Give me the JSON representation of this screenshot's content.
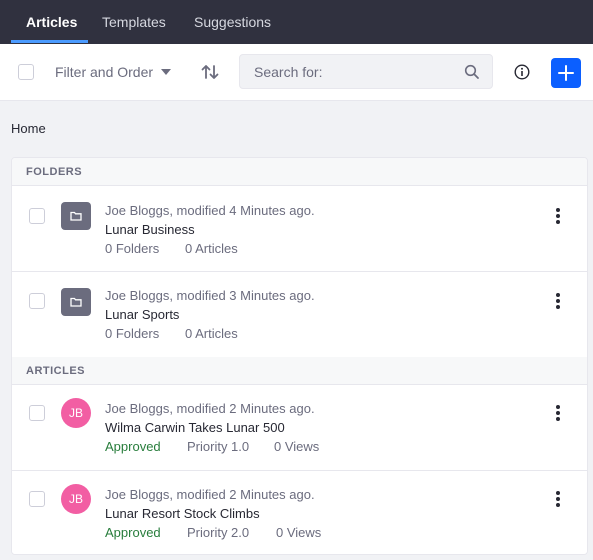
{
  "nav": {
    "tabs": [
      {
        "label": "Articles",
        "active": true
      },
      {
        "label": "Templates",
        "active": false
      },
      {
        "label": "Suggestions",
        "active": false
      }
    ]
  },
  "toolbar": {
    "filter_label": "Filter and Order",
    "search_placeholder": "Search for:",
    "accent_color": "#0b5fff"
  },
  "breadcrumb": "Home",
  "folders": {
    "header": "FOLDERS",
    "items": [
      {
        "meta": "Joe Bloggs, modified 4 Minutes ago.",
        "title": "Lunar Business",
        "subfolders": "0 Folders",
        "articles": "0 Articles",
        "icon": "folder-icon"
      },
      {
        "meta": "Joe Bloggs, modified 3 Minutes ago.",
        "title": "Lunar Sports",
        "subfolders": "0 Folders",
        "articles": "0 Articles",
        "icon": "folder-icon"
      }
    ]
  },
  "articles": {
    "header": "ARTICLES",
    "items": [
      {
        "initials": "JB",
        "meta": "Joe Bloggs, modified 2 Minutes ago.",
        "title": "Wilma Carwin Takes Lunar 500",
        "status": "Approved",
        "priority": "Priority 1.0",
        "views": "0 Views"
      },
      {
        "initials": "JB",
        "meta": "Joe Bloggs, modified 2 Minutes ago.",
        "title": "Lunar Resort Stock Climbs",
        "status": "Approved",
        "priority": "Priority 2.0",
        "views": "0 Views"
      }
    ]
  }
}
